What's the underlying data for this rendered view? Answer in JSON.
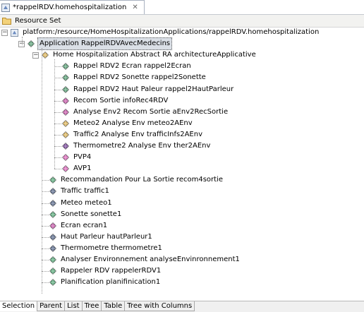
{
  "tab": {
    "title": "*rappelRDV.homehospitalization",
    "icon": "model-file-icon",
    "close_icon": "close-icon"
  },
  "resource_set": {
    "label": "Resource Set",
    "icon": "resource-folder-icon"
  },
  "tree": {
    "root": "platform:/resource/HomeHospitalizationApplications/rappelRDV.homehospitalization",
    "application": "Application RappelRDVAvecMedecins",
    "architecture": "Home Hospitalization Abstract RA architectureApplicative",
    "arch_children": [
      {
        "label": "Rappel RDV2 Ecran rappel2Ecran",
        "color": "#5a9e76"
      },
      {
        "label": "Rappel RDV2 Sonette rappel2Sonette",
        "color": "#5a9e76"
      },
      {
        "label": "Rappel RDV2 Haut Paleur rappel2HautParleur",
        "color": "#5a9e76"
      },
      {
        "label": "Recom Sortie infoRec4RDV",
        "color": "#c45aa8"
      },
      {
        "label": "Analyse Env2 Recom Sortie aEnv2RecSortie",
        "color": "#c45aa8"
      },
      {
        "label": "Meteo2 Analyse Env meteo2AEnv",
        "color": "#d8b25a"
      },
      {
        "label": "Traffic2 Analyse Env trafficInfs2AEnv",
        "color": "#d8b25a"
      },
      {
        "label": "Thermometre2 Analyse Env ther2AEnv",
        "color": "#7a4a9a"
      },
      {
        "label": "PVP4",
        "color": "#d86ab8"
      },
      {
        "label": "AVP1",
        "color": "#d86ab8"
      }
    ],
    "app_children": [
      {
        "label": "Recommandation Pour La Sortie recom4sortie",
        "color": "#5aa87a"
      },
      {
        "label": "Traffic traffic1",
        "color": "#5a6a8a"
      },
      {
        "label": "Meteo meteo1",
        "color": "#5a6a8a"
      },
      {
        "label": "Sonette sonette1",
        "color": "#5aa87a"
      },
      {
        "label": "Ecran ecran1",
        "color": "#c45aa8"
      },
      {
        "label": "Haut Parleur hautParleur1",
        "color": "#5a6a8a"
      },
      {
        "label": "Thermometre thermometre1",
        "color": "#5a6a8a"
      },
      {
        "label": "Analyser Environnement analyseEnvinronnement1",
        "color": "#5aa87a"
      },
      {
        "label": "Rappeler RDV rappelerRDV1",
        "color": "#5aa87a"
      },
      {
        "label": "Planification planifinication1",
        "color": "#5aa87a"
      }
    ]
  },
  "bottom_tabs": [
    "Selection",
    "Parent",
    "List",
    "Tree",
    "Table",
    "Tree with Columns"
  ]
}
